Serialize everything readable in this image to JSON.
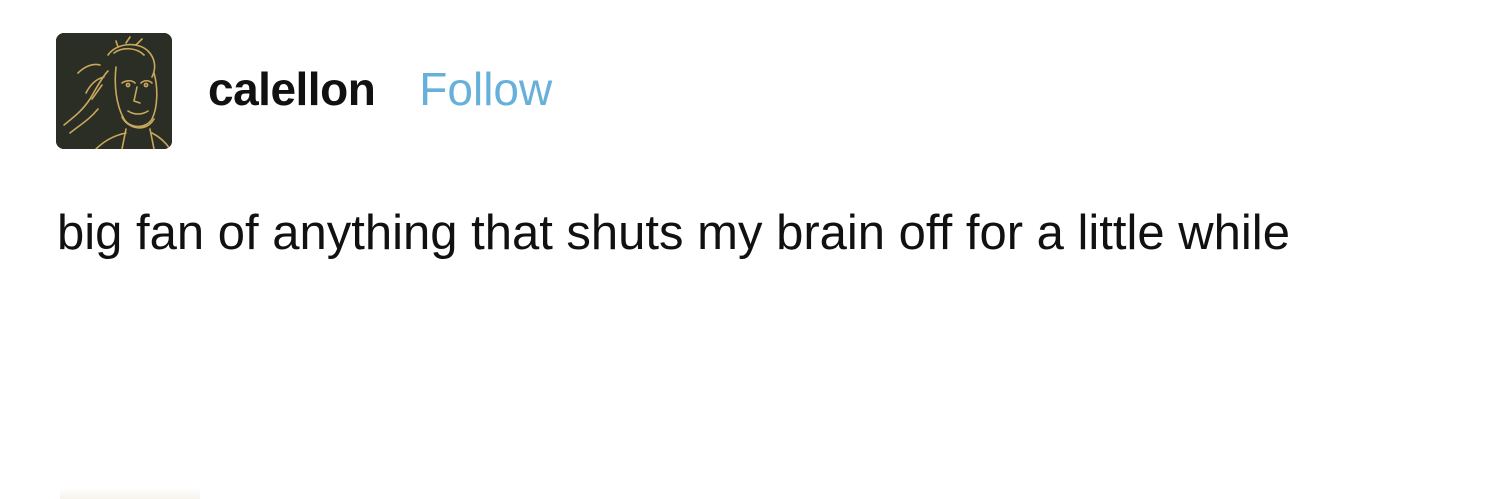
{
  "post": {
    "author": {
      "username": "calellon",
      "avatar_icon": "portrait-sketch-avatar",
      "avatar_colors": {
        "background": "#2a2e25",
        "lines": "#c9a85c"
      }
    },
    "follow_label": "Follow",
    "follow_color": "#66b0da",
    "text": "big fan of anything that shuts my brain off for a little while"
  }
}
